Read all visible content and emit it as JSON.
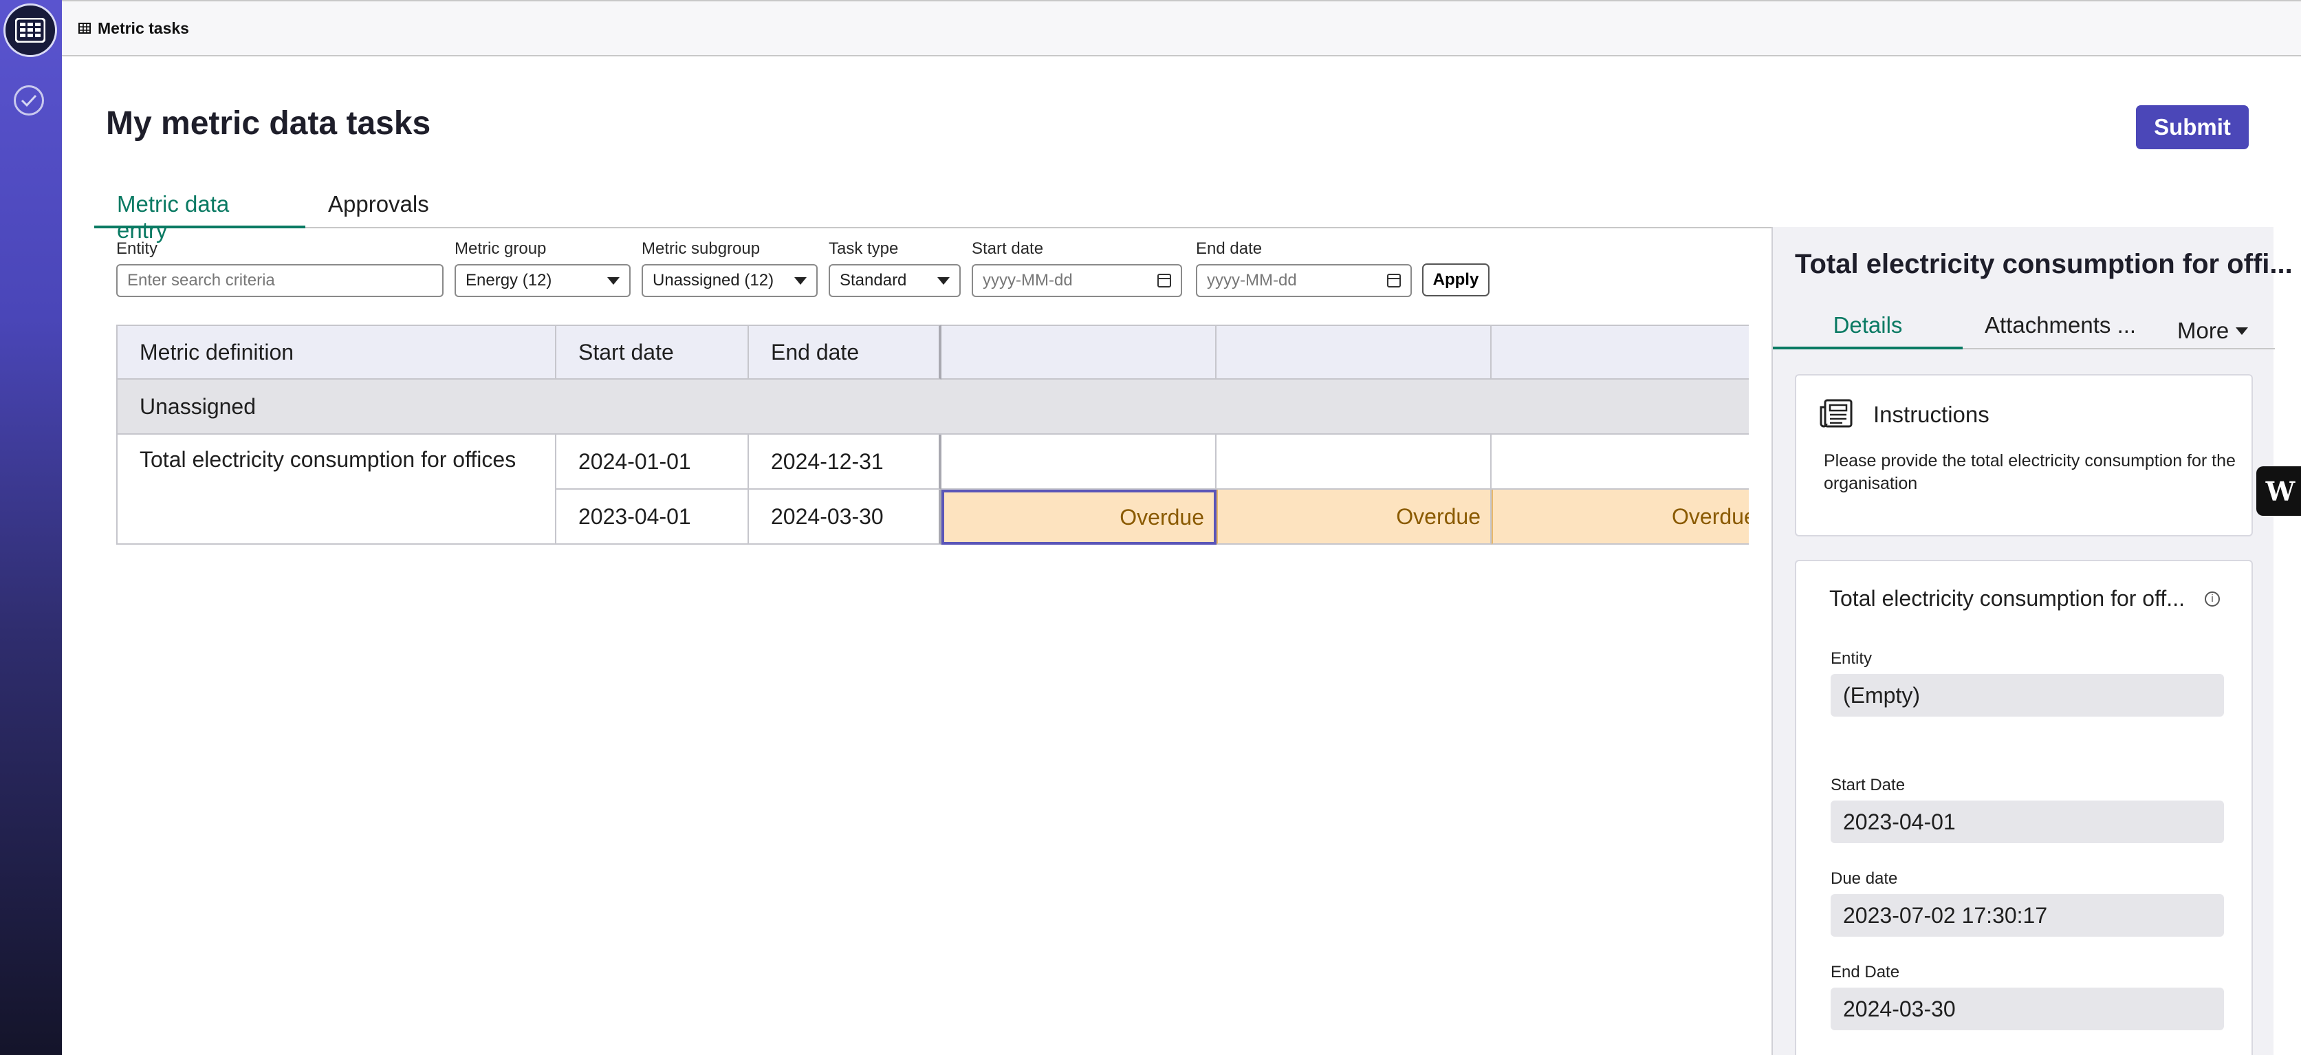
{
  "app": {
    "tab_title": "Metric tasks",
    "page_title": "My metric data tasks",
    "submit_label": "Submit"
  },
  "tabs": [
    {
      "label": "Metric data entry",
      "active": true
    },
    {
      "label": "Approvals",
      "active": false
    }
  ],
  "filters": {
    "entity": {
      "label": "Entity",
      "placeholder": "Enter search criteria"
    },
    "metric_group": {
      "label": "Metric group",
      "value": "Energy (12)"
    },
    "metric_subgroup": {
      "label": "Metric subgroup",
      "value": "Unassigned (12)"
    },
    "task_type": {
      "label": "Task type",
      "value": "Standard"
    },
    "start_date": {
      "label": "Start date",
      "placeholder": "yyyy-MM-dd"
    },
    "end_date": {
      "label": "End date",
      "placeholder": "yyyy-MM-dd"
    },
    "apply_label": "Apply"
  },
  "grid": {
    "headers": {
      "metric": "Metric definition",
      "start": "Start date",
      "end": "End date"
    },
    "group": "Unassigned",
    "metric_name": "Total electricity consumption for offices",
    "rows": [
      {
        "start": "2024-01-01",
        "end": "2024-12-31",
        "cells": [
          "",
          "",
          ""
        ]
      },
      {
        "start": "2023-04-01",
        "end": "2024-03-30",
        "cells": [
          "Overdue",
          "Overdue",
          "Overdue"
        ]
      }
    ]
  },
  "panel": {
    "title": "Total electricity consumption for offi...",
    "tabs": {
      "details": "Details",
      "attachments": "Attachments ...",
      "more": "More"
    },
    "instructions": {
      "title": "Instructions",
      "text": "Please provide the total electricity consumption for the organisation"
    },
    "detail_card": {
      "title": "Total electricity consumption for off...",
      "entity_label": "Entity",
      "entity_value": "(Empty)",
      "start_label": "Start Date",
      "start_value": "2023-04-01",
      "due_label": "Due date",
      "due_value": "2023-07-02 17:30:17",
      "end_label": "End Date",
      "end_value": "2024-03-30"
    }
  },
  "colors": {
    "accent": "#4b47b8",
    "active_tab": "#0a7a63",
    "overdue_bg": "#fde3bf"
  }
}
